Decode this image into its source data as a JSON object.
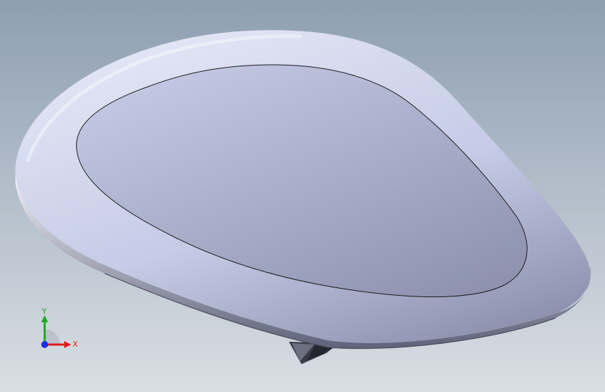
{
  "viewport": {
    "background_top": "#8e9fb2",
    "background_bottom": "#d9dee3"
  },
  "model": {
    "name": "cad-part",
    "face_light": "#c6cbe6",
    "face_mid": "#aeb3d2",
    "face_dark": "#8d91ad",
    "rim_light": "#e4e7f6",
    "rim_shadow": "#5f637a",
    "edge_color": "#1a1a1a",
    "spike_color": "#3a3d48"
  },
  "triad": {
    "x_label": "X",
    "y_label": "Y",
    "x_color": "#e01b1b",
    "y_color": "#1ea81e",
    "z_color": "#1b2fe0"
  }
}
